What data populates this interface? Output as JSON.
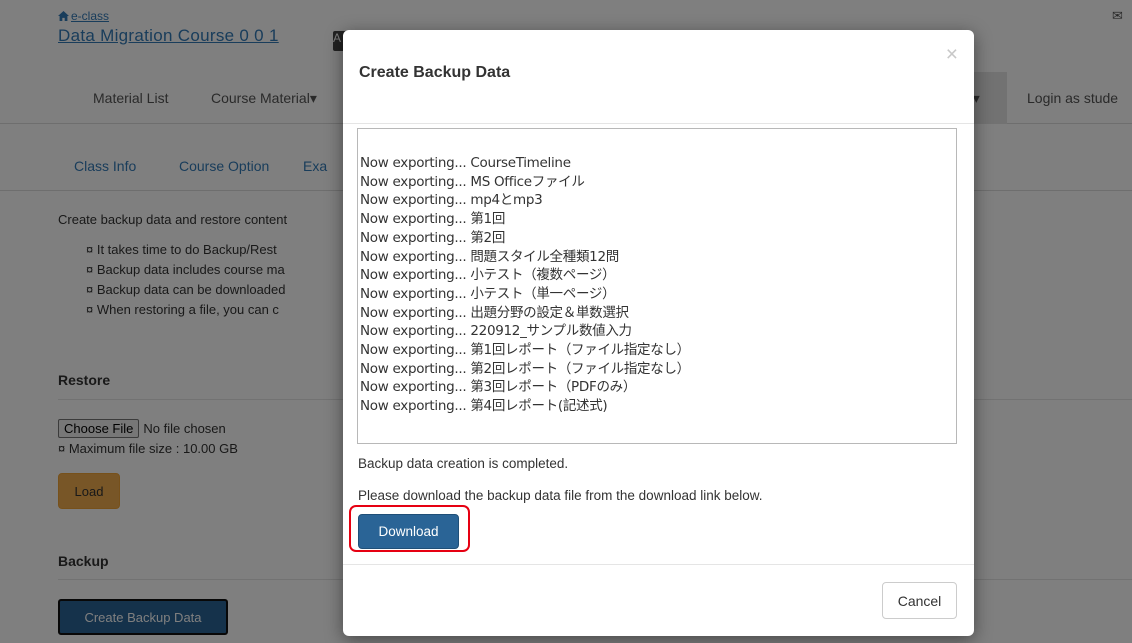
{
  "header": {
    "home_link": "e-class",
    "course_title": "Data Migration Course 0 0 1",
    "course_badge": "A"
  },
  "topnav": {
    "material_list": "Material List",
    "course_material": "Course Material▾",
    "more_menu": "n▾",
    "login_as_student": "Login as stude"
  },
  "subnav": {
    "class_info": "Class Info",
    "course_option": "Course Option",
    "exam": "Exa"
  },
  "content": {
    "intro": "Create backup data and restore content",
    "bullets": [
      "¤ It takes time to do Backup/Rest",
      "¤ Backup data includes course ma",
      "¤ Backup data can be downloaded",
      "¤ When restoring a file, you can c"
    ],
    "restore_heading": "Restore",
    "choose_file_label": "Choose File",
    "no_file_text": "No file chosen",
    "max_size": "¤ Maximum file size : 10.00 GB",
    "load_label": "Load",
    "backup_heading": "Backup",
    "create_backup_label": "Create Backup Data"
  },
  "modal": {
    "title": "Create Backup Data",
    "close_symbol": "×",
    "log_lines": [
      "Now exporting... CourseTimeline",
      "Now exporting... MS Officeファイル",
      "Now exporting... mp4とmp3",
      "Now exporting... 第1回",
      "Now exporting... 第2回",
      "Now exporting... 問題スタイル全種類12問",
      "Now exporting... 小テスト（複数ページ）",
      "Now exporting... 小テスト（単一ページ）",
      "Now exporting... 出題分野の設定＆単数選択",
      "Now exporting... 220912_サンプル数値入力",
      "Now exporting... 第1回レポート（ファイル指定なし）",
      "Now exporting... 第2回レポート（ファイル指定なし）",
      "Now exporting... 第3回レポート（PDFのみ）",
      "Now exporting... 第4回レポート(記述式)"
    ],
    "completed_message": "Backup data creation is completed.",
    "download_message": "Please download the backup data file from the download link below.",
    "download_label": "Download",
    "cancel_label": "Cancel"
  },
  "colors": {
    "link": "#337ab7",
    "primary_button": "#2a6496",
    "warning_button": "#f0ad4e",
    "highlight": "#e60012"
  }
}
